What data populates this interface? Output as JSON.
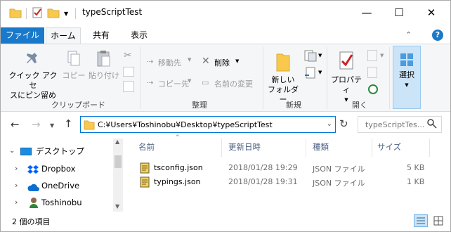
{
  "window": {
    "title": "typeScriptTest",
    "minimize_glyph": "—",
    "maximize_glyph": "☐",
    "close_glyph": "✕",
    "help_glyph": "?",
    "collapse_glyph": "⌃"
  },
  "tabs": {
    "file": "ファイル",
    "home": "ホーム",
    "share": "共有",
    "view": "表示"
  },
  "ribbon": {
    "pin_label1": "クイック アクセ",
    "pin_label2": "スにピン留め",
    "copy_label": "コピー",
    "paste_label": "貼り付け",
    "move_to": "移動先",
    "copy_to": "コピー先",
    "delete": "削除",
    "rename": "名前の変更",
    "new_folder1": "新しい",
    "new_folder2": "フォルダー",
    "properties": "プロパティ",
    "select": "選択",
    "group_clipboard": "クリップボード",
    "group_organize": "整理",
    "group_new": "新規",
    "group_open": "開く"
  },
  "address": {
    "path": "C:¥Users¥Toshinobu¥Desktop¥typeScriptTest",
    "search_placeholder": "typeScriptTes..."
  },
  "nav": {
    "items": [
      {
        "label": "デスクトップ"
      },
      {
        "label": "Dropbox"
      },
      {
        "label": "OneDrive"
      },
      {
        "label": "Toshinobu"
      }
    ]
  },
  "columns": {
    "name": "名前",
    "date": "更新日時",
    "type": "種類",
    "size": "サイズ"
  },
  "files": [
    {
      "name": "tsconfig.json",
      "date": "2018/01/28 19:29",
      "type": "JSON ファイル",
      "size": "5 KB"
    },
    {
      "name": "typings.json",
      "date": "2018/01/28 19:31",
      "type": "JSON ファイル",
      "size": "1 KB"
    }
  ],
  "status": {
    "count": "2 個の項目"
  },
  "colors": {
    "accent": "#1979ca",
    "folder": "#f8c94c",
    "ribbon_bg": "#f5f6f7"
  }
}
